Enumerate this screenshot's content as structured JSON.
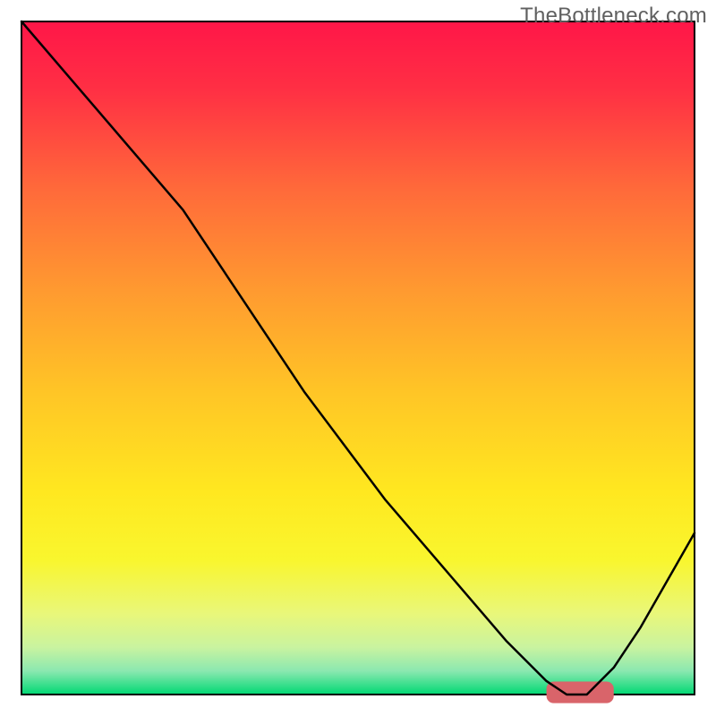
{
  "watermark": "TheBottleneck.com",
  "chart_data": {
    "type": "line",
    "title": "",
    "xlabel": "",
    "ylabel": "",
    "xlim": [
      0,
      100
    ],
    "ylim": [
      0,
      100
    ],
    "x": [
      0,
      6,
      12,
      18,
      24,
      30,
      36,
      42,
      48,
      54,
      60,
      66,
      72,
      78,
      81,
      84,
      88,
      92,
      96,
      100
    ],
    "values": [
      100,
      93,
      86,
      79,
      72,
      63,
      54,
      45,
      37,
      29,
      22,
      15,
      8,
      2,
      0,
      0,
      4,
      10,
      17,
      24
    ],
    "background_gradient": {
      "stops": [
        {
          "offset": 0.0,
          "color": "#ff1648"
        },
        {
          "offset": 0.1,
          "color": "#ff2f44"
        },
        {
          "offset": 0.25,
          "color": "#ff6a3a"
        },
        {
          "offset": 0.4,
          "color": "#ff9a30"
        },
        {
          "offset": 0.55,
          "color": "#ffc526"
        },
        {
          "offset": 0.7,
          "color": "#ffe820"
        },
        {
          "offset": 0.8,
          "color": "#f9f62e"
        },
        {
          "offset": 0.88,
          "color": "#e9f77a"
        },
        {
          "offset": 0.93,
          "color": "#c9f3a0"
        },
        {
          "offset": 0.965,
          "color": "#8be8b0"
        },
        {
          "offset": 1.0,
          "color": "#00d873"
        }
      ]
    },
    "optimum_bar": {
      "x_start": 78,
      "x_end": 88,
      "color": "#d9646a",
      "thickness_pct": 3.2
    },
    "plot_frame": {
      "inset_pct": 3.0,
      "stroke": "#000000",
      "stroke_width": 2
    },
    "curve_style": {
      "stroke": "#000000",
      "stroke_width": 2.5
    }
  }
}
